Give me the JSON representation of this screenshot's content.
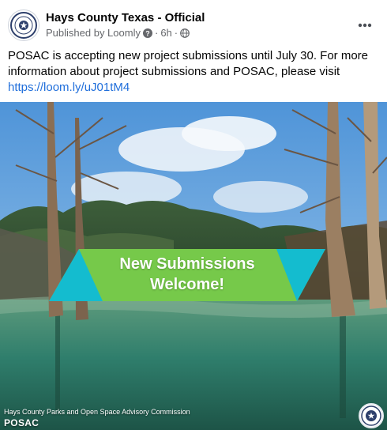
{
  "post": {
    "author": "Hays County Texas - Official",
    "published_by": "Published by Loomly",
    "dot1": "·",
    "time": "6h",
    "dot2": "·",
    "body_text": "POSAC is accepting new project submissions until July 30. For more information about project submissions and POSAC, please visit ",
    "link_text": "https://loom.ly/uJ01tM4",
    "icons": [
      "county-seal-icon",
      "info-icon",
      "globe-icon",
      "more-options-icon"
    ]
  },
  "image": {
    "banner_line1": "New Submissions",
    "banner_line2": "Welcome!",
    "caption_line1": "Hays County Parks and Open Space Advisory Commission",
    "caption_line2": "POSAC",
    "colors": {
      "banner_green": "#76c94a",
      "banner_teal": "#14bccf",
      "water": "#2e7d6d",
      "sky": "#6da9df"
    }
  }
}
